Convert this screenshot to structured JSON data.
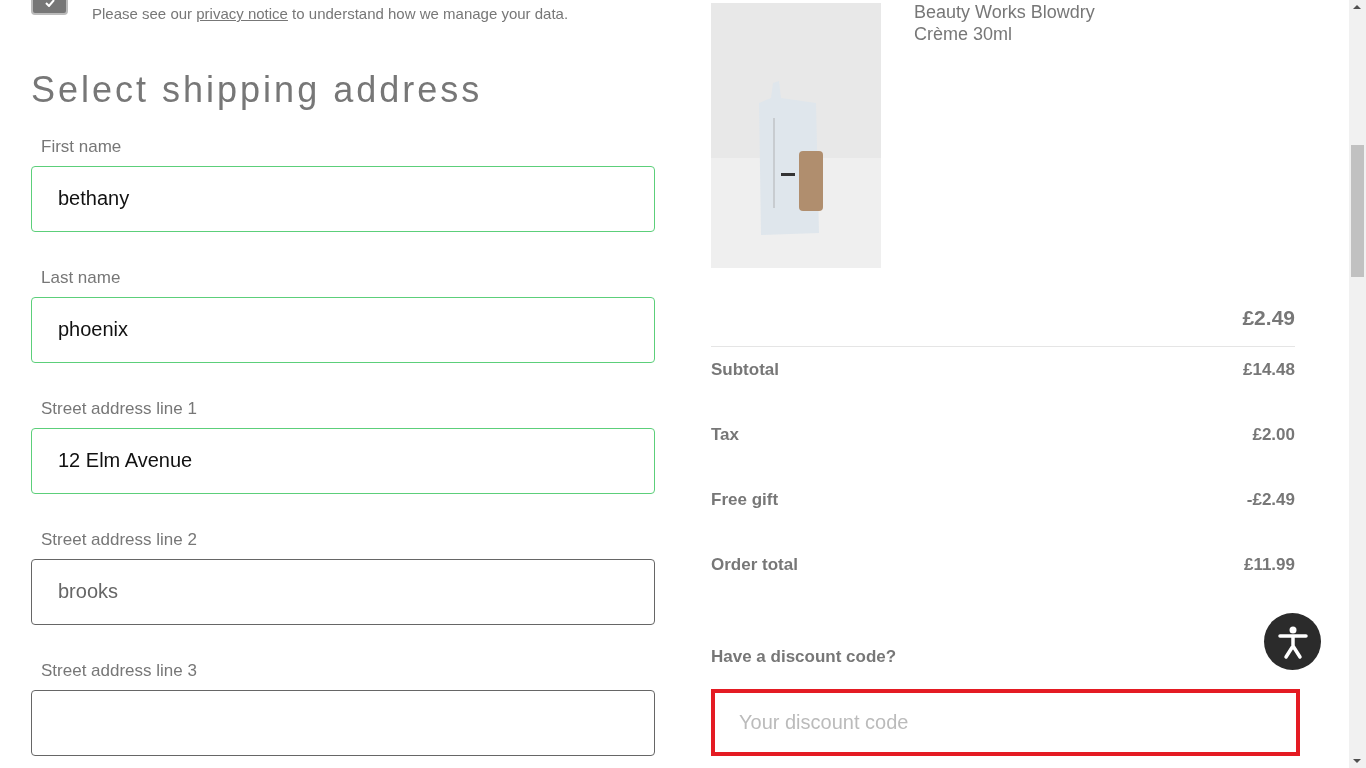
{
  "consent": {
    "checked": true,
    "text_before": "Please see our ",
    "link": "privacy notice",
    "text_after": " to understand how we manage your data."
  },
  "shipping": {
    "title": "Select shipping address",
    "fields": [
      {
        "label": "First name",
        "value": "bethany",
        "valid": true
      },
      {
        "label": "Last name",
        "value": "phoenix",
        "valid": true
      },
      {
        "label": "Street address line 1",
        "value": "12 Elm Avenue",
        "valid": true
      },
      {
        "label": "Street address line 2",
        "value": "brooks",
        "valid": false
      },
      {
        "label": "Street address line 3",
        "valid": false
      }
    ]
  },
  "order": {
    "item": {
      "name": "Beauty Works Blowdry Crème 30ml",
      "price": "£2.49"
    },
    "totals": [
      {
        "label": "Subtotal",
        "value": "£14.48"
      },
      {
        "label": "Tax",
        "value": "£2.00"
      },
      {
        "label": "Free gift",
        "value": "-£2.49"
      },
      {
        "label": "Order total",
        "value": "£11.99"
      }
    ],
    "discount": {
      "label": "Have a discount code?",
      "placeholder": "Your discount code",
      "error": true
    }
  }
}
